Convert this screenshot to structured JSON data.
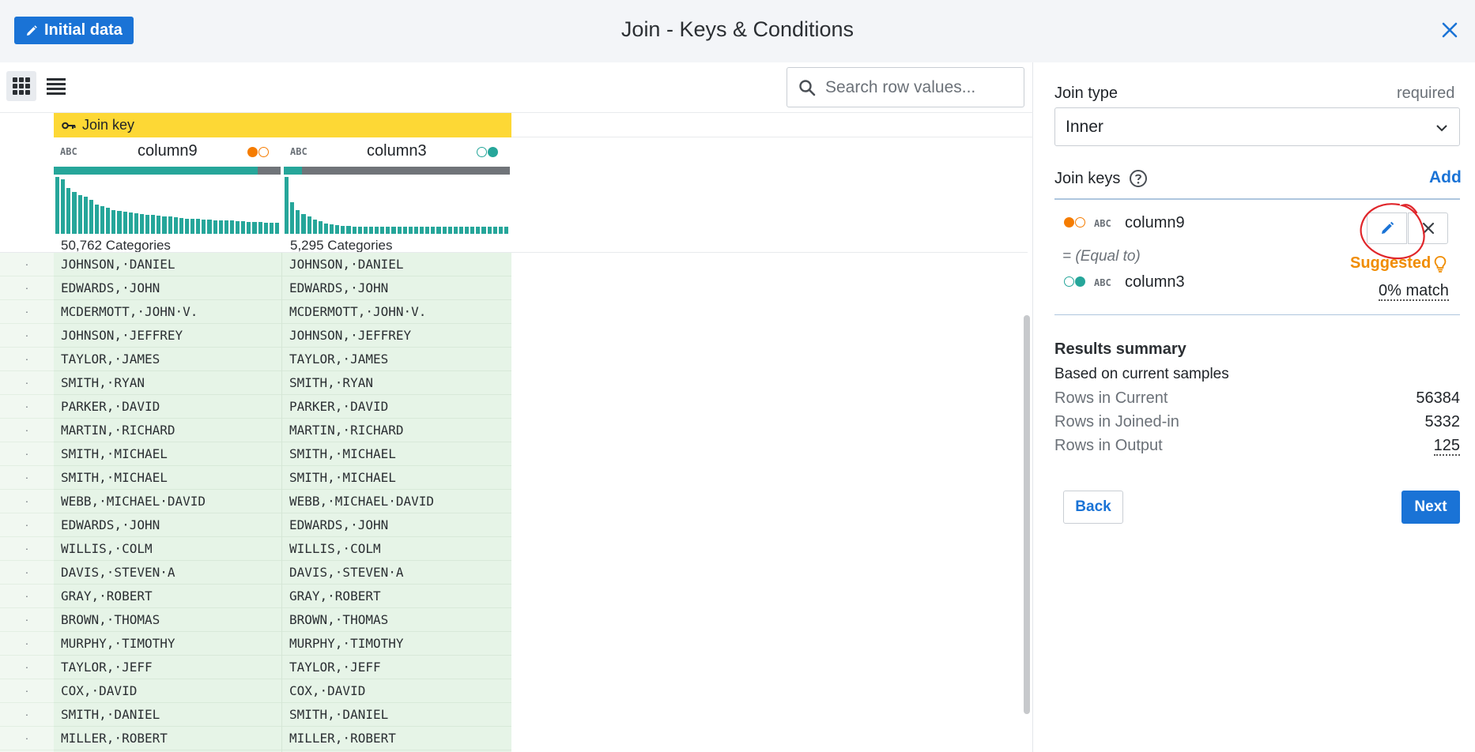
{
  "header": {
    "initial_button": "Initial data",
    "title": "Join - Keys & Conditions"
  },
  "toolbar": {
    "search_placeholder": "Search row values..."
  },
  "table": {
    "join_key_label": "Join key",
    "columns": [
      {
        "type": "ABC",
        "name": "column9",
        "categories": "50,762 Categories",
        "fill_fraction": 0.9,
        "dot_colors": [
          "#f57c00",
          "#ffffff"
        ]
      },
      {
        "type": "ABC",
        "name": "column3",
        "categories": "5,295 Categories",
        "fill_fraction": 0.08,
        "dot_colors": [
          "#ffffff",
          "#26a69a"
        ]
      }
    ],
    "histogram_heights": [
      [
        1.0,
        0.96,
        0.8,
        0.74,
        0.68,
        0.65,
        0.6,
        0.52,
        0.48,
        0.46,
        0.42,
        0.4,
        0.39,
        0.37,
        0.36,
        0.35,
        0.34,
        0.33,
        0.32,
        0.3,
        0.3,
        0.29,
        0.28,
        0.27,
        0.27,
        0.26,
        0.25,
        0.25,
        0.24,
        0.24,
        0.23,
        0.23,
        0.22,
        0.22,
        0.21,
        0.21,
        0.21,
        0.2,
        0.2,
        0.2
      ],
      [
        1.0,
        0.55,
        0.42,
        0.35,
        0.3,
        0.25,
        0.22,
        0.18,
        0.16,
        0.15,
        0.14,
        0.14,
        0.13,
        0.13,
        0.13,
        0.12,
        0.12,
        0.12,
        0.12,
        0.12,
        0.12,
        0.12,
        0.12,
        0.12,
        0.12,
        0.12,
        0.12,
        0.12,
        0.12,
        0.12,
        0.12,
        0.12,
        0.12,
        0.12,
        0.12,
        0.12,
        0.12,
        0.12,
        0.12,
        0.12
      ]
    ],
    "rows": [
      "JOHNSON,·DANIEL",
      "EDWARDS,·JOHN",
      "MCDERMOTT,·JOHN·V.",
      "JOHNSON,·JEFFREY",
      "TAYLOR,·JAMES",
      "SMITH,·RYAN",
      "PARKER,·DAVID",
      "MARTIN,·RICHARD",
      "SMITH,·MICHAEL",
      "SMITH,·MICHAEL",
      "WEBB,·MICHAEL·DAVID",
      "EDWARDS,·JOHN",
      "WILLIS,·COLM",
      "DAVIS,·STEVEN·A",
      "GRAY,·ROBERT",
      "BROWN,·THOMAS",
      "MURPHY,·TIMOTHY",
      "TAYLOR,·JEFF",
      "COX,·DAVID",
      "SMITH,·DANIEL",
      "MILLER,·ROBERT"
    ],
    "row_index_marker": "·"
  },
  "panel": {
    "join_type_label": "Join type",
    "join_type_required": "required",
    "join_type_value": "Inner",
    "join_keys_label": "Join keys",
    "add_label": "Add",
    "key_left": {
      "type": "ABC",
      "name": "column9"
    },
    "key_right": {
      "type": "ABC",
      "name": "column3"
    },
    "condition": "= (Equal to)",
    "suggested": "Suggested",
    "match": "0% match",
    "summary_title": "Results summary",
    "summary_subtitle": "Based on current samples",
    "summary": [
      {
        "label": "Rows in Current",
        "value": "56384"
      },
      {
        "label": "Rows in Joined-in",
        "value": "5332"
      },
      {
        "label": "Rows in Output",
        "value": "125"
      }
    ],
    "back_label": "Back",
    "next_label": "Next"
  },
  "colors": {
    "accent": "#1a73d6",
    "join_band": "#fdd835",
    "teal": "#26a69a",
    "orange": "#f57c00",
    "suggested": "#f08c00",
    "annotation": "#e0262b"
  }
}
